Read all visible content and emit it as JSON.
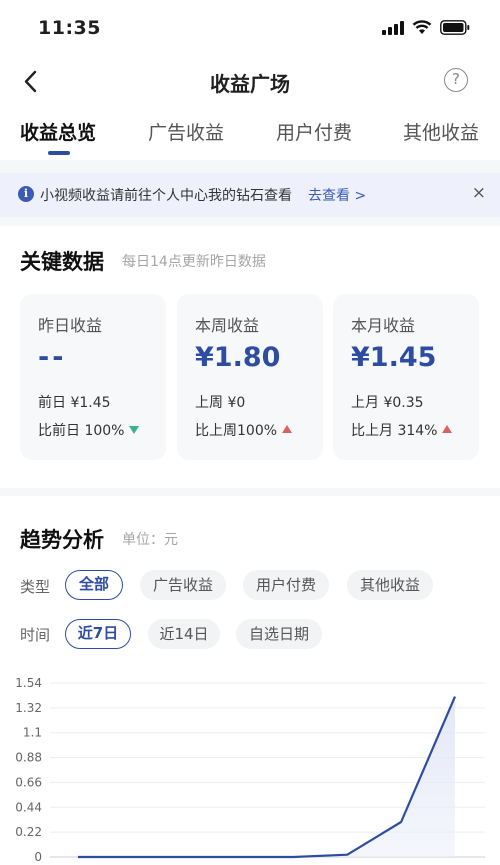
{
  "status": {
    "time": "11:35"
  },
  "nav": {
    "title": "收益广场",
    "help": "?"
  },
  "tabs": [
    {
      "label": "收益总览",
      "active": true
    },
    {
      "label": "广告收益",
      "active": false
    },
    {
      "label": "用户付费",
      "active": false
    },
    {
      "label": "其他收益",
      "active": false
    }
  ],
  "notice": {
    "icon": "info-icon",
    "text": "小视频收益请前往个人中心我的钻石查看",
    "link": "去查看 >",
    "close": "×"
  },
  "key_data": {
    "title": "关键数据",
    "subtitle": "每日14点更新昨日数据",
    "cards": [
      {
        "label": "昨日收益",
        "value": "--",
        "prev": "前日 ¥1.45",
        "compare": "比前日 100%",
        "trend": "down"
      },
      {
        "label": "本周收益",
        "value": "¥1.80",
        "prev": "上周 ¥0",
        "compare": "比上周100%",
        "trend": "up"
      },
      {
        "label": "本月收益",
        "value": "¥1.45",
        "prev": "上月 ¥0.35",
        "compare": "比上月 314%",
        "trend": "up"
      }
    ]
  },
  "trend": {
    "title": "趋势分析",
    "unit": "单位：元",
    "type_label": "类型",
    "type_options": [
      {
        "label": "全部",
        "active": true
      },
      {
        "label": "广告收益",
        "active": false
      },
      {
        "label": "用户付费",
        "active": false
      },
      {
        "label": "其他收益",
        "active": false
      }
    ],
    "time_label": "时间",
    "time_options": [
      {
        "label": "近7日",
        "active": true
      },
      {
        "label": "近14日",
        "active": false
      },
      {
        "label": "自选日期",
        "active": false
      }
    ]
  },
  "colors": {
    "accent": "#2d4da2",
    "up": "#e0615c",
    "down": "#3bb38a"
  },
  "chart_data": {
    "type": "line",
    "y_ticks": [
      "1.54",
      "1.32",
      "1.1",
      "0.88",
      "0.66",
      "0.44",
      "0.22",
      "0"
    ],
    "ylim": [
      0,
      1.54
    ],
    "series": [
      {
        "values": [
          0,
          0,
          0,
          0,
          0,
          0.02,
          0.31,
          1.42
        ]
      }
    ],
    "grid": true
  }
}
